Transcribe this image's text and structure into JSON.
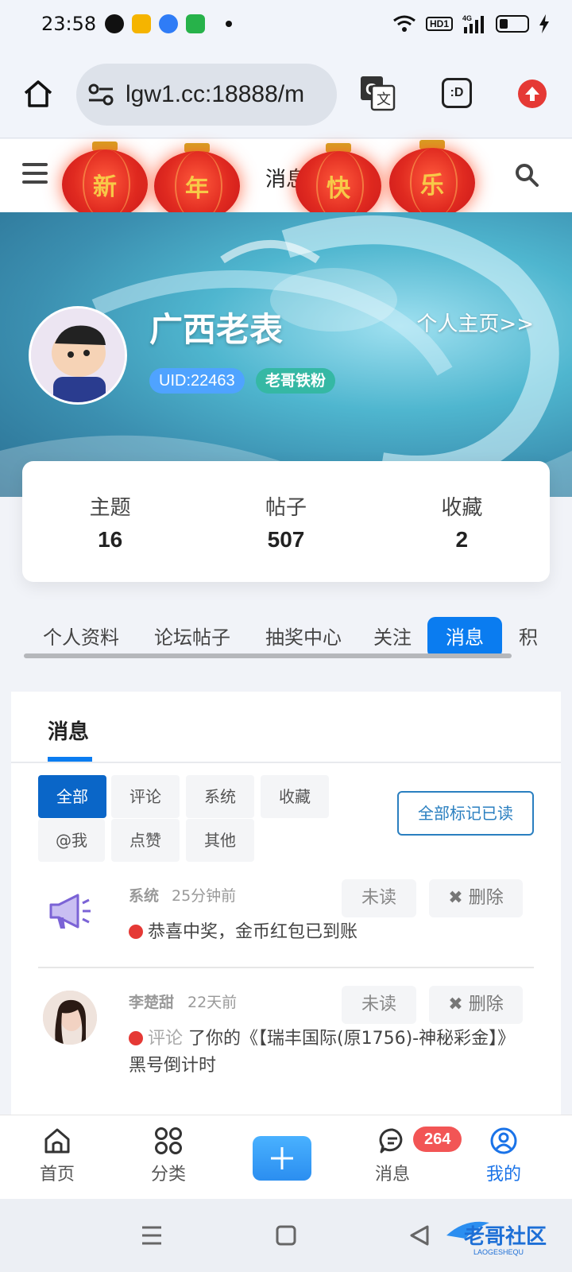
{
  "status_bar": {
    "time": "23:58",
    "hd": "HD1",
    "network": "4G",
    "icons": [
      "messenger-icon",
      "mail-icon",
      "browser-icon",
      "app-icon",
      "wifi-icon",
      "signal-icon",
      "battery-icon",
      "charging-icon"
    ]
  },
  "browser": {
    "url": "lgw1.cc:18888/m",
    "tab_label": ":D",
    "icons": [
      "home-icon",
      "site-settings-icon",
      "translate-icon",
      "tab-switcher-icon",
      "update-icon"
    ]
  },
  "header": {
    "title": "消息",
    "lanterns": [
      "新",
      "年",
      "快",
      "乐"
    ]
  },
  "profile": {
    "username": "广西老表",
    "uid": "UID:22463",
    "level": "老哥铁粉",
    "homepage_link": "个人主页>>"
  },
  "stats": [
    {
      "label": "主题",
      "value": "16"
    },
    {
      "label": "帖子",
      "value": "507"
    },
    {
      "label": "收藏",
      "value": "2"
    }
  ],
  "profile_tabs": [
    "个人资料",
    "论坛帖子",
    "抽奖中心",
    "关注",
    "消息",
    "积"
  ],
  "messages_panel": {
    "tab": "消息",
    "filters": [
      "全部",
      "评论",
      "系统",
      "收藏",
      "@我",
      "点赞",
      "其他"
    ],
    "mark_all_read": "全部标记已读",
    "items": [
      {
        "sender": "系统",
        "time": "25分钟前",
        "unread_label": "未读",
        "delete_label": "✖ 删除",
        "category": "",
        "text": "恭喜中奖，金币红包已到账"
      },
      {
        "sender": "李楚甜",
        "time": "22天前",
        "unread_label": "未读",
        "delete_label": "✖ 删除",
        "category": "评论",
        "text": "了你的《【瑞丰国际(原1756)-神秘彩金】》黑号倒计时"
      }
    ]
  },
  "bottom_nav": {
    "items": [
      "首页",
      "分类",
      "消息",
      "我的"
    ],
    "badge": "264",
    "active": "我的"
  },
  "colors": {
    "accent": "#0a7cf0",
    "badge_red": "#f25555",
    "lantern_red": "#e02a20"
  }
}
